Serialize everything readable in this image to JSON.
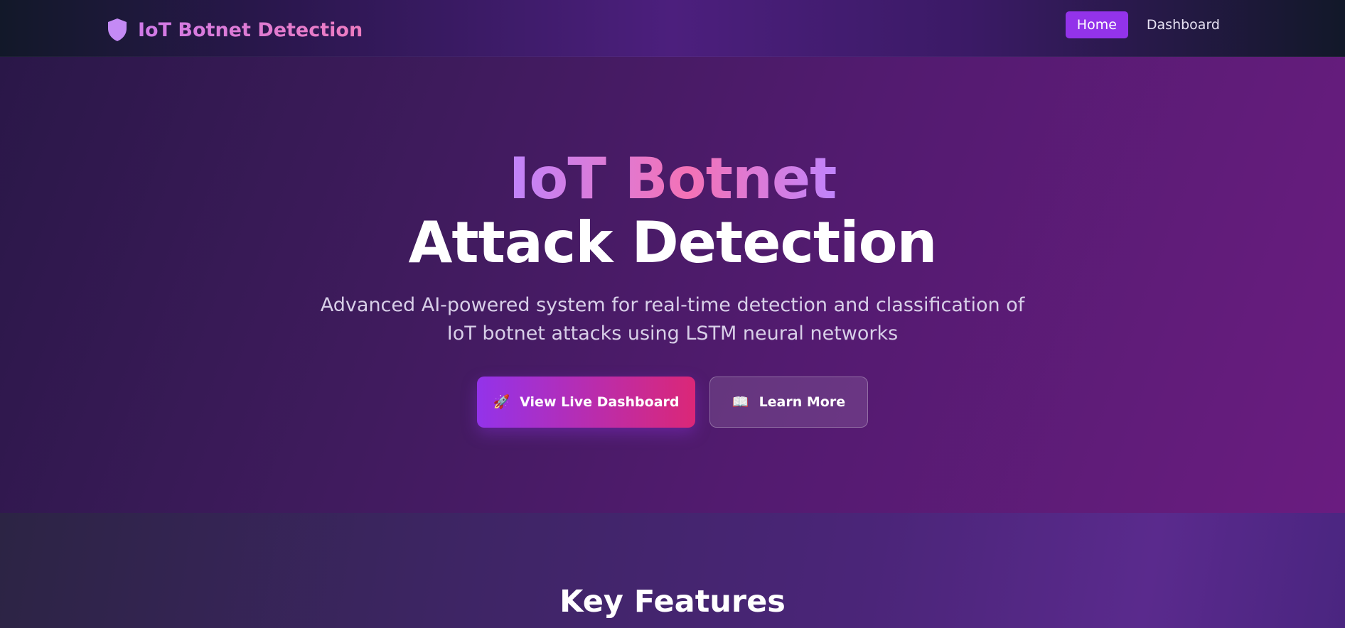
{
  "navbar": {
    "brand_icon": "shield-icon",
    "brand_text": "IoT Botnet Detection",
    "links": [
      {
        "label": "Home",
        "active": true
      },
      {
        "label": "Dashboard",
        "active": false
      }
    ]
  },
  "hero": {
    "title_line1": "IoT Botnet",
    "title_line2": "Attack Detection",
    "subtitle": "Advanced AI-powered system for real-time detection and classification of IoT botnet attacks using LSTM neural networks",
    "primary_button": {
      "icon": "🚀",
      "icon_name": "rocket-icon",
      "label": "View Live Dashboard"
    },
    "secondary_button": {
      "icon": "📖",
      "icon_name": "book-icon",
      "label": "Learn More"
    }
  },
  "features": {
    "title": "Key Features"
  },
  "colors": {
    "accent": "#9333ea",
    "accent_pink": "#db2777",
    "brand_gradient_start": "#c084fc",
    "brand_gradient_end": "#f472b6"
  }
}
